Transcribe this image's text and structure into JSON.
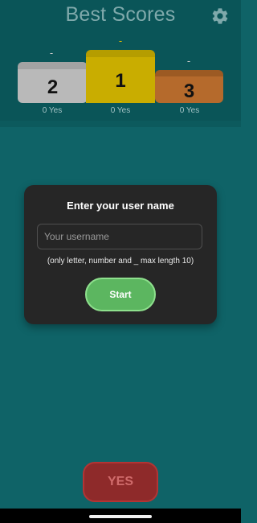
{
  "header": {
    "title": "Best Scores",
    "settings_icon": "gear-icon"
  },
  "podium": [
    {
      "rank": "2",
      "name": "-",
      "score": "0 Yes",
      "color": "#b9b9b9"
    },
    {
      "rank": "1",
      "name": "-",
      "score": "0 Yes",
      "color": "#c9ad00"
    },
    {
      "rank": "3",
      "name": "-",
      "score": "0 Yes",
      "color": "#b56a2c"
    }
  ],
  "dialog": {
    "title": "Enter your user name",
    "input_placeholder": "Your username",
    "input_value": "",
    "hint": "(only letter, number and _ max length 10)",
    "start_label": "Start"
  },
  "yes_button": {
    "label": "YES"
  },
  "colors": {
    "background": "#0f6367",
    "dialog": "#262626",
    "start": "#5cb660",
    "yes": "#8e2a2a"
  }
}
